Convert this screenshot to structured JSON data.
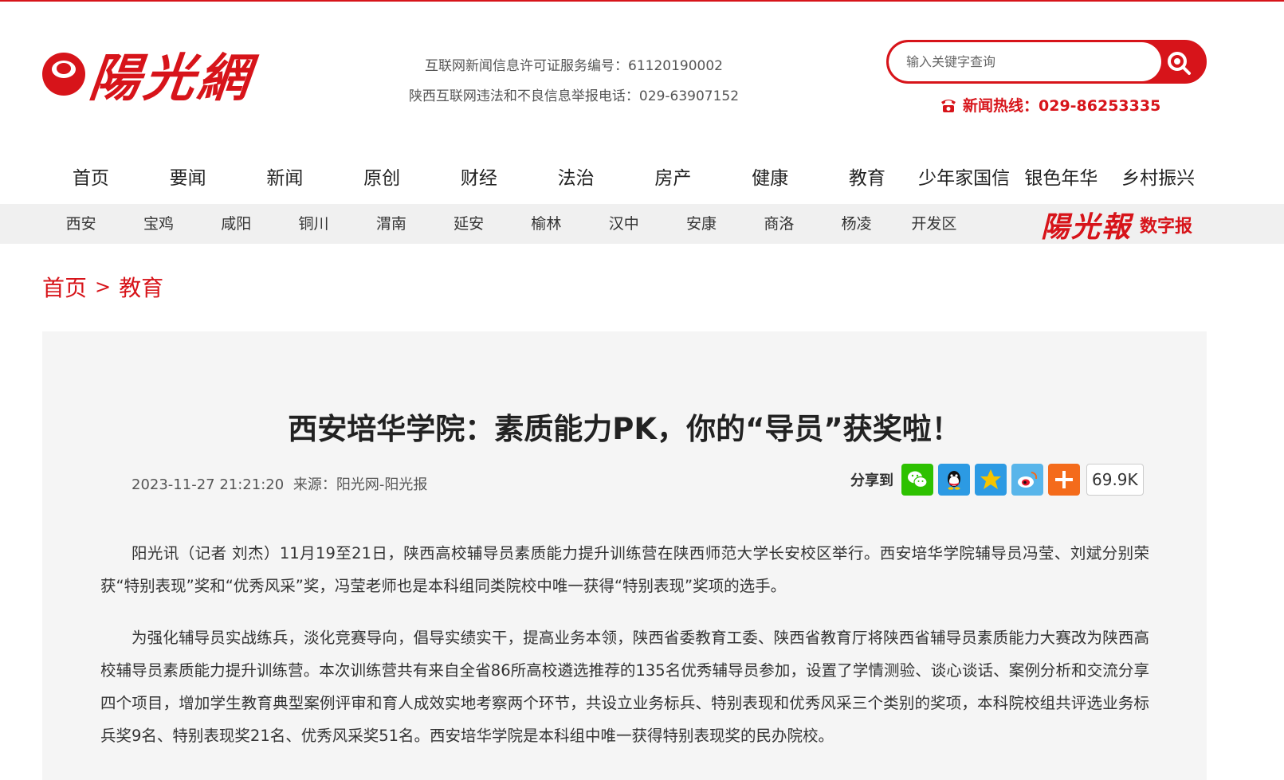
{
  "site": {
    "logo_text": "陽光網",
    "license_line": "互联网新闻信息许可证服务编号：61120190002",
    "report_line": "陕西互联网违法和不良信息举报电话：029-63907152",
    "search_placeholder": "输入关键字查询",
    "hotline": "新闻热线：029-86253335"
  },
  "main_nav": [
    "首页",
    "要闻",
    "新闻",
    "原创",
    "财经",
    "法治",
    "房产",
    "健康",
    "教育",
    "少年家国信",
    "银色年华",
    "乡村振兴"
  ],
  "sub_nav": [
    "西安",
    "宝鸡",
    "咸阳",
    "铜川",
    "渭南",
    "延安",
    "榆林",
    "汉中",
    "安康",
    "商洛",
    "杨凌",
    "开发区"
  ],
  "digital_paper": {
    "logo": "陽光報",
    "label": "数字报"
  },
  "breadcrumb": {
    "home": "首页",
    "separator": ">",
    "current": "教育"
  },
  "article": {
    "title": "西安培华学院：素质能力PK，你的“导员”获奖啦！",
    "datetime": "2023-11-27 21:21:20",
    "source": "来源：阳光网-阳光报",
    "share_label": "分享到",
    "share_count": "69.9K",
    "paragraphs": [
      "阳光讯（记者 刘杰）11月19至21日，陕西高校辅导员素质能力提升训练营在陕西师范大学长安校区举行。西安培华学院辅导员冯莹、刘斌分别荣获“特别表现”奖和“优秀风采”奖，冯莹老师也是本科组同类院校中唯一获得“特别表现”奖项的选手。",
      "为强化辅导员实战练兵，淡化竞赛导向，倡导实绩实干，提高业务本领，陕西省委教育工委、陕西省教育厅将陕西省辅导员素质能力大赛改为陕西高校辅导员素质能力提升训练营。本次训练营共有来自全省86所高校遴选推荐的135名优秀辅导员参加，设置了学情测验、谈心谈话、案例分析和交流分享四个项目，增加学生教育典型案例评审和育人成效实地考察两个环节，共设立业务标兵、特别表现和优秀风采三个类别的奖项，本科院校组共评选业务标兵奖9名、特别表现奖21名、优秀风采奖51名。西安培华学院是本科组中唯一获得特别表现奖的民办院校。"
    ]
  },
  "colors": {
    "brand_red": "#d7141a",
    "wechat": "#2dc100",
    "qq": "#2c9ae3",
    "qzone": "#f5c400",
    "weibo": "#e6162d",
    "more": "#f46b1b"
  },
  "icons": [
    "search-icon",
    "phone-icon",
    "wechat-icon",
    "qq-icon",
    "qzone-icon",
    "weibo-icon",
    "more-share-icon"
  ]
}
